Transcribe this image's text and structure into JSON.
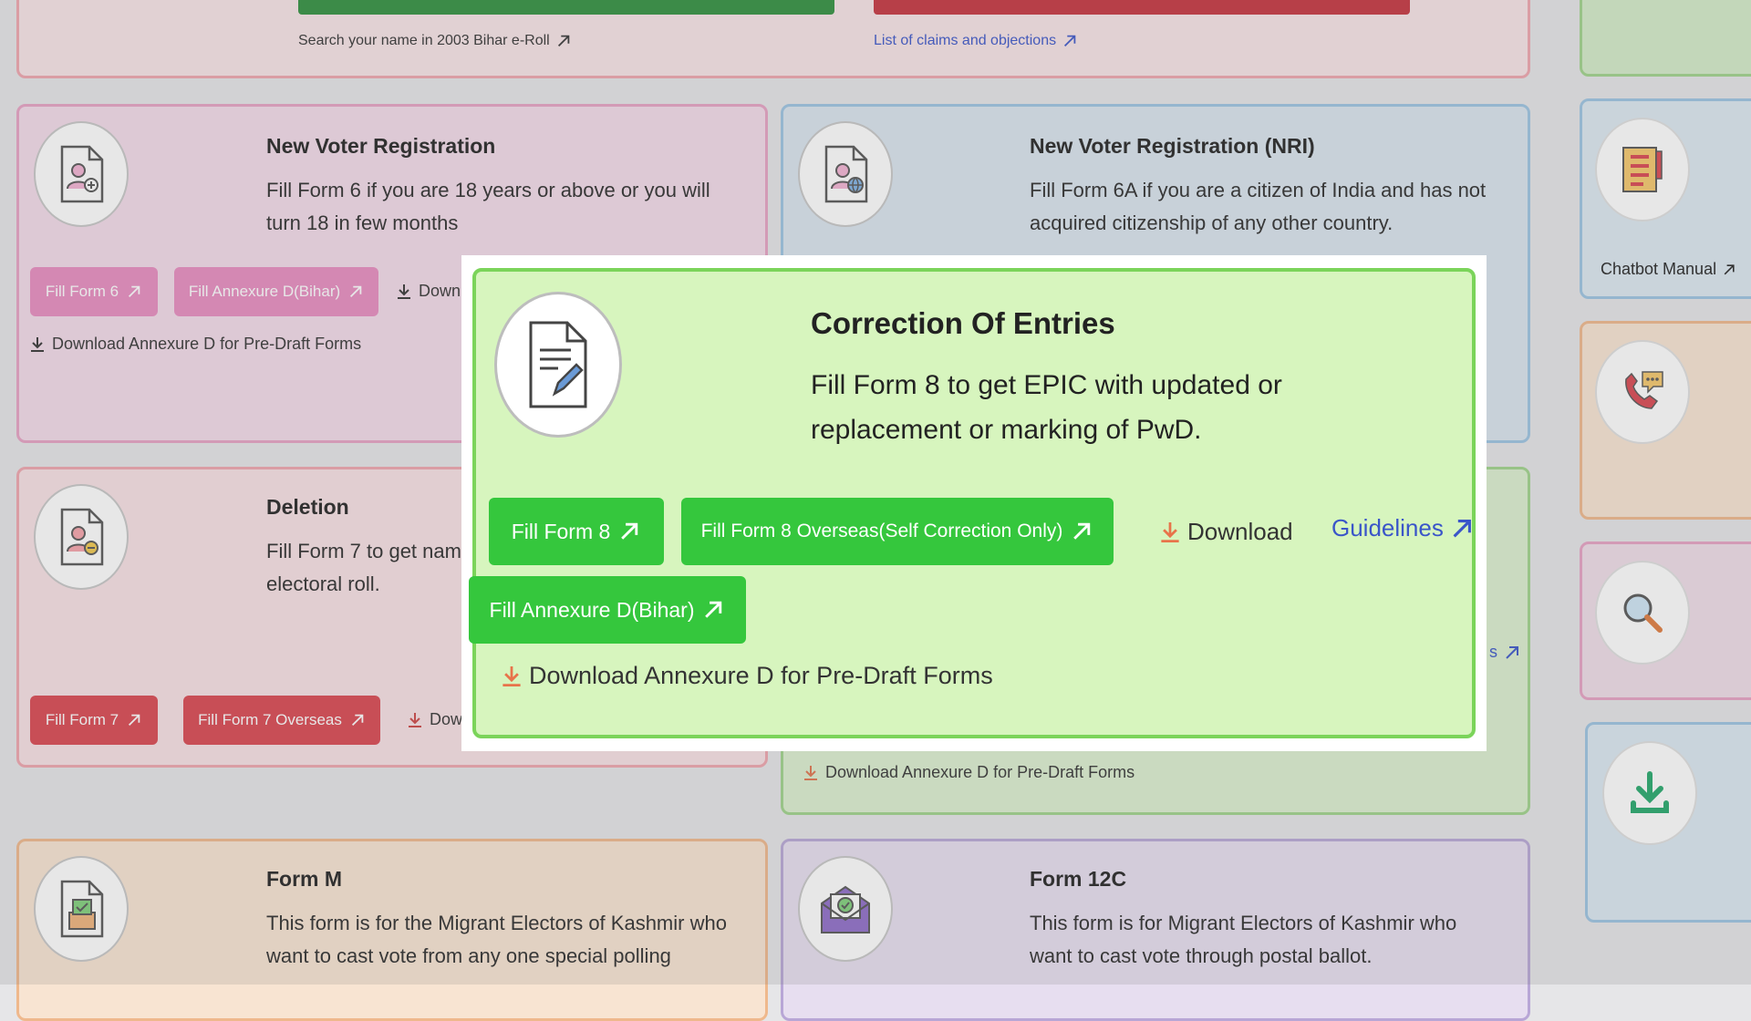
{
  "top_links": {
    "search_eroll": "Search your name in 2003 Bihar e-Roll",
    "claims_objections": "List of claims and objections"
  },
  "cards": {
    "new_voter": {
      "title": "New Voter Registration",
      "description": "Fill Form 6 if you are 18 years or above or you will turn 18 in few months",
      "btn_form": "Fill Form 6",
      "btn_annexure": "Fill Annexure D(Bihar)",
      "download": "Down",
      "download_annexure": "Download Annexure D for Pre-Draft Forms"
    },
    "nri": {
      "title": "New Voter Registration (NRI)",
      "description": "Fill Form 6A if you are a citizen of India and has not acquired citizenship of any other country."
    },
    "deletion": {
      "title": "Deletion",
      "description_line1": "Fill Form 7 to get name",
      "description_line2": "electoral roll.",
      "btn_form": "Fill Form 7",
      "btn_overseas": "Fill Form 7 Overseas",
      "download": "Dow"
    },
    "correction_bg": {
      "guidelines_fragment": "s",
      "download_annexure": "Download Annexure D for Pre-Draft Forms"
    },
    "form_m": {
      "title": "Form M",
      "description": "This form is for the Migrant Electors of Kashmir who want to cast vote from any one special polling"
    },
    "form_12c": {
      "title": "Form 12C",
      "description": "This form is for Migrant Electors of Kashmir who want to cast vote through postal ballot."
    }
  },
  "sidebar": {
    "chatbot_manual": "Chatbot Manual"
  },
  "modal": {
    "title": "Correction Of Entries",
    "description": "Fill Form 8 to get EPIC with updated or replacement or marking of PwD.",
    "btn_form8": "Fill Form 8",
    "btn_form8_overseas": "Fill Form 8 Overseas(Self Correction Only)",
    "download": "Download",
    "guidelines": "Guidelines",
    "btn_annexure": "Fill Annexure D(Bihar)",
    "download_annexure": "Download Annexure D for Pre-Draft Forms"
  },
  "colors": {
    "accent_blue": "#3a55c9",
    "green_button": "#35c73d",
    "red_button": "#d9454f",
    "pink_button": "#e88cc0"
  }
}
